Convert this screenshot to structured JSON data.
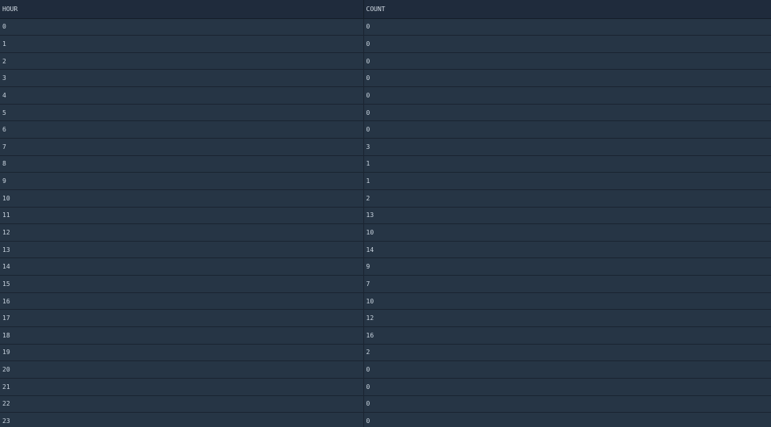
{
  "table": {
    "columns": [
      "HOUR",
      "COUNT"
    ],
    "rows": [
      [
        "0",
        "0"
      ],
      [
        "1",
        "0"
      ],
      [
        "2",
        "0"
      ],
      [
        "3",
        "0"
      ],
      [
        "4",
        "0"
      ],
      [
        "5",
        "0"
      ],
      [
        "6",
        "0"
      ],
      [
        "7",
        "3"
      ],
      [
        "8",
        "1"
      ],
      [
        "9",
        "1"
      ],
      [
        "10",
        "2"
      ],
      [
        "11",
        "13"
      ],
      [
        "12",
        "10"
      ],
      [
        "13",
        "14"
      ],
      [
        "14",
        "9"
      ],
      [
        "15",
        "7"
      ],
      [
        "16",
        "10"
      ],
      [
        "17",
        "12"
      ],
      [
        "18",
        "16"
      ],
      [
        "19",
        "2"
      ],
      [
        "20",
        "0"
      ],
      [
        "21",
        "0"
      ],
      [
        "22",
        "0"
      ],
      [
        "23",
        "0"
      ]
    ]
  },
  "colors": {
    "background": "#263545",
    "header_background": "#1f2b3c",
    "text": "#c9d4df",
    "grid_line": "#1a2431"
  }
}
